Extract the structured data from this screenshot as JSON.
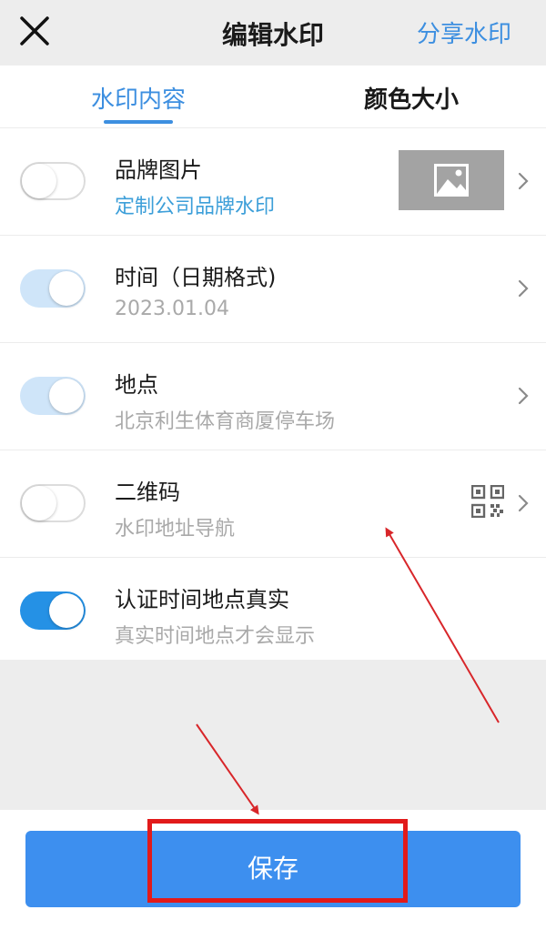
{
  "header": {
    "title": "编辑水印",
    "share_label": "分享水印"
  },
  "tabs": [
    {
      "label": "水印内容",
      "active": true
    },
    {
      "label": "颜色大小",
      "active": false
    }
  ],
  "items": [
    {
      "title": "品牌图片",
      "subtitle": "定制公司品牌水印",
      "toggle": "off"
    },
    {
      "title": "时间（日期格式)",
      "subtitle": "2023.01.04",
      "toggle": "on-disabled"
    },
    {
      "title": "地点",
      "subtitle": "北京利生体育商厦停车场",
      "toggle": "on-disabled"
    },
    {
      "title": "二维码",
      "subtitle": "水印地址导航",
      "toggle": "off"
    },
    {
      "title": "认证时间地点真实",
      "subtitle": "真实时间地点才会显示",
      "toggle": "on"
    }
  ],
  "footer": {
    "save_label": "保存"
  },
  "colors": {
    "accent": "#3d8fe0",
    "toggle_on": "#2591e5",
    "annotation": "#e21a1a"
  }
}
